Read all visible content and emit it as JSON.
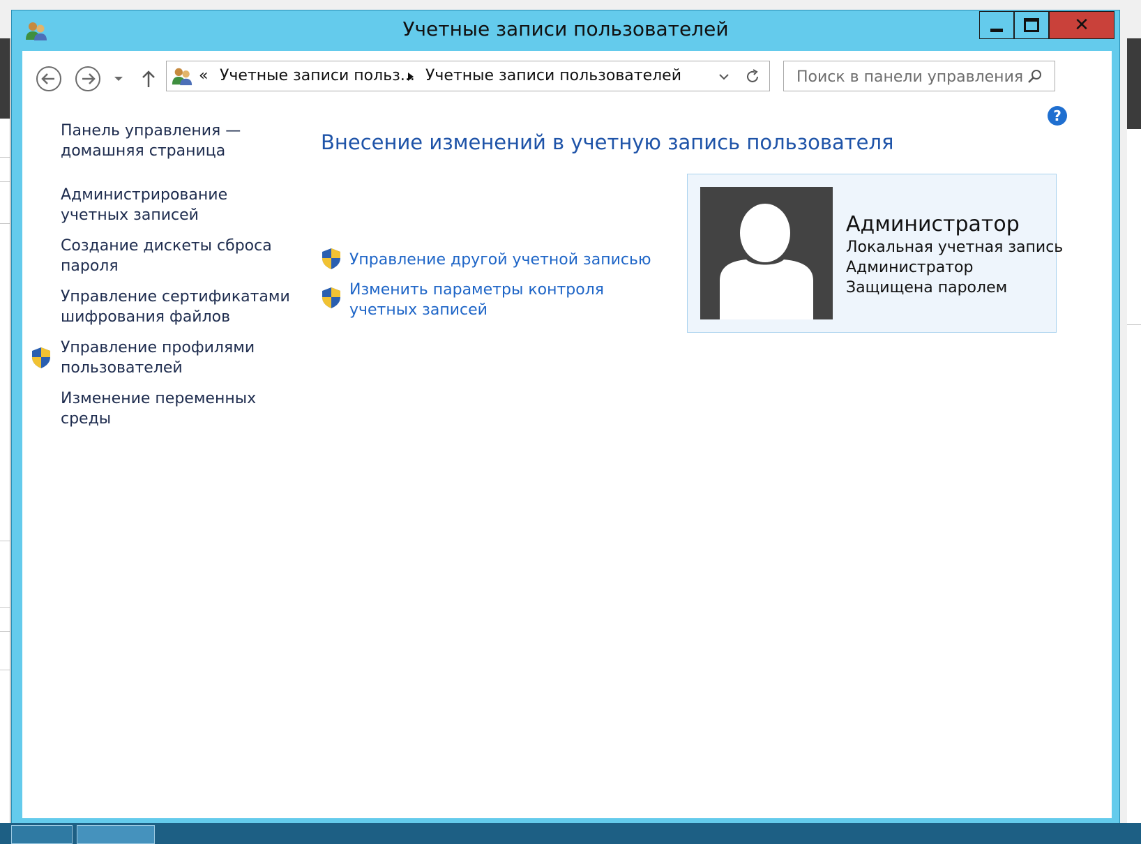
{
  "window": {
    "title": "Учетные записи пользователей",
    "icon": "users-icon"
  },
  "address_bar": {
    "overflow": "«",
    "crumb1": "Учетные записи польз...",
    "crumb2": "Учетные записи пользователей"
  },
  "search": {
    "placeholder": "Поиск в панели управления"
  },
  "sidebar": {
    "items": [
      {
        "label": "Панель управления — домашняя страница"
      },
      {
        "label": "Администрирование учетных записей"
      },
      {
        "label": "Создание дискеты сброса пароля"
      },
      {
        "label": "Управление сертификатами шифрования файлов"
      },
      {
        "label": "Управление профилями пользователей",
        "icon": "uac-shield-icon"
      },
      {
        "label": "Изменение переменных среды"
      }
    ]
  },
  "main": {
    "heading": "Внесение изменений в учетную запись пользователя",
    "tasks": [
      {
        "label": "Управление другой учетной записью",
        "icon": "uac-shield-icon"
      },
      {
        "label": "Изменить параметры контроля учетных записей",
        "icon": "uac-shield-icon"
      }
    ]
  },
  "user_card": {
    "name": "Администратор",
    "account_type": "Локальная учетная запись",
    "group": "Администратор",
    "status": "Защищена паролем"
  },
  "colors": {
    "titlebar": "#64cbec",
    "close_button": "#c9413a",
    "heading": "#1e53a8",
    "link": "#1e65c7",
    "sidebar_link": "#1e2c4e"
  }
}
